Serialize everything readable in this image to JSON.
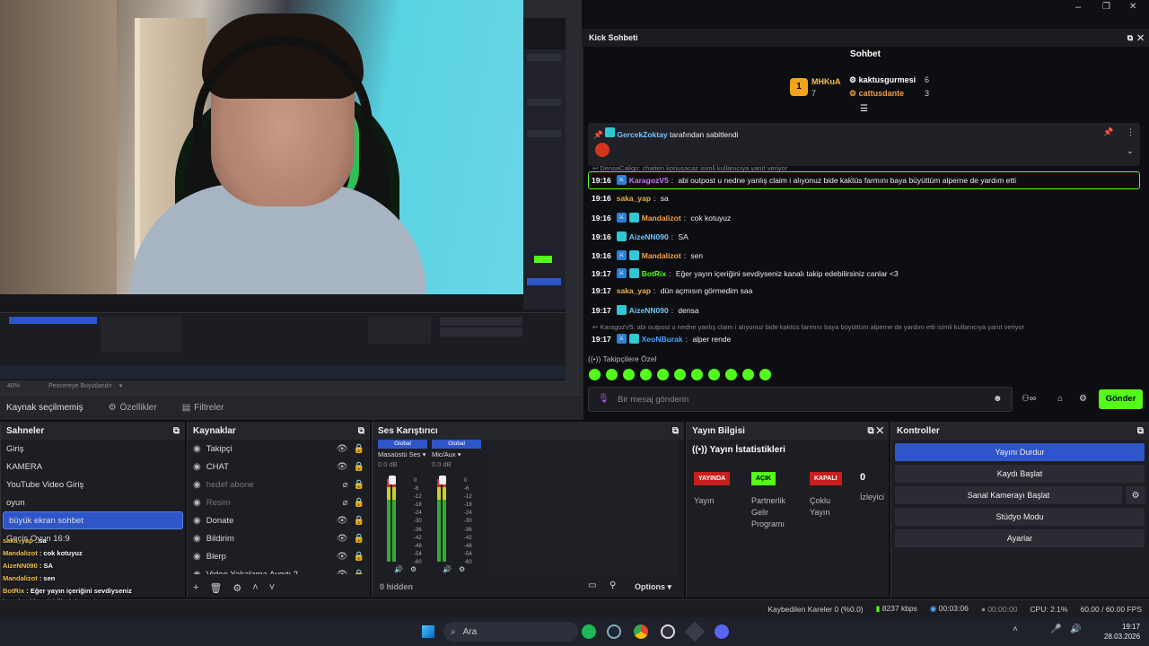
{
  "window": {
    "controls": [
      "–",
      "❐",
      "✕"
    ]
  },
  "preview": {
    "zoom": "48%",
    "fit_label": "Pencereye Boyutlandır"
  },
  "source_bar": {
    "status": "Kaynak seçilmemiş",
    "properties": "Özellikler",
    "filters": "Filtreler"
  },
  "scenes": {
    "title": "Sahneler",
    "items": [
      "Giriş",
      "KAMERA",
      "YouTube Video Giriş",
      "oyun",
      "büyük ekran sohbet",
      "Geçiş Oyun 16:9"
    ],
    "selected_index": 4
  },
  "sources": {
    "title": "Kaynaklar",
    "items": [
      {
        "name": "Takipçi",
        "visible": true
      },
      {
        "name": "CHAT",
        "visible": true
      },
      {
        "name": "hedef abone",
        "visible": false
      },
      {
        "name": "Resim",
        "visible": false
      },
      {
        "name": "Donate",
        "visible": true
      },
      {
        "name": "Bildirim",
        "visible": true
      },
      {
        "name": "Blerp",
        "visible": true
      },
      {
        "name": "Video Yakalama Aygıtı 2",
        "visible": true
      }
    ]
  },
  "mixer": {
    "title": "Ses Karıştırıcı",
    "channels": [
      {
        "label": "Global",
        "name": "Masaüstü Ses",
        "db": "0.0 dB",
        "level": 0.33
      },
      {
        "label": "Global",
        "name": "Mic/Aux",
        "db": "0.0 dB",
        "level": 0.33
      }
    ],
    "ticks": [
      "0",
      "-6",
      "-12",
      "-18",
      "-24",
      "-30",
      "-36",
      "-42",
      "-48",
      "-54",
      "-60"
    ],
    "hidden": "0 hidden",
    "options": "Options"
  },
  "stream_info": {
    "title": "Yayın Bilgisi",
    "stats_title": "Yayın İstatistikleri",
    "badges": [
      {
        "text": "YAYINDA",
        "color": "#c81e1e",
        "label": "Yayın"
      },
      {
        "text": "AÇIK",
        "color": "#53fc18",
        "label": "Partnerlik Gelir Programı"
      },
      {
        "text": "KAPALI",
        "color": "#c81e1e",
        "label": "Çoklu Yayın"
      }
    ],
    "viewers": "0",
    "viewers_label": "İzleyici"
  },
  "controls": {
    "title": "Kontroller",
    "buttons": [
      "Yayını Durdur",
      "Kaydı Başlat",
      "Sanal Kamerayı Başlat",
      "Stüdyo Modu",
      "Ayarlar"
    ]
  },
  "status_bar": {
    "dropped": "Kaybedilen Kareler 0 (%0.0)",
    "bitrate": "8237 kbps",
    "live_time": "00:03:06",
    "rec_time": "00:00:00",
    "cpu": "CPU: 2.1%",
    "fps": "60.00 / 60.00 FPS"
  },
  "kick": {
    "window_title": "Kick Sohbeti",
    "header": "Sohbet",
    "leaderboard": [
      {
        "rank": "1",
        "name": "MHKuA",
        "count": "7"
      },
      {
        "name": "kaktusgurmesi",
        "count": "6"
      },
      {
        "name": "cattusdante",
        "count": "3"
      }
    ],
    "pinned_by": "GercekZoktay",
    "pinned_suffix": "tarafından sabitlendi",
    "reply_hint_1": "DensaCaligo: chatten konuşacaz isimli kullanıcıya yanıt veriyor",
    "messages": [
      {
        "time": "19:16",
        "user": "KaragozV5",
        "color": "#d271ff",
        "text": "abi outpost u nedne yanlış claim i alıyonuz bide kaktüs farmını baya büyüttüm alperne de yardım etti"
      },
      {
        "time": "19:16",
        "user": "saka_yap",
        "color": "#e8b04a",
        "text": "sa"
      },
      {
        "time": "19:16",
        "user": "Mandalizot",
        "color": "#f4a24a",
        "text": "cok kotuyuz"
      },
      {
        "time": "19:16",
        "user": "AizeNN090",
        "color": "#6fc5ff",
        "text": "SA"
      },
      {
        "time": "19:16",
        "user": "Mandalizot",
        "color": "#f4a24a",
        "text": "sen"
      },
      {
        "time": "19:17",
        "user": "BotRix",
        "color": "#53fc18",
        "text": "Eğer yayın içeriğini sevdiyseniz kanalı takip edebilirsiniz canlar <3"
      },
      {
        "time": "19:17",
        "user": "saka_yap",
        "color": "#e8b04a",
        "text": "dün açmısın görmedim saa"
      },
      {
        "time": "19:17",
        "user": "AizeNN090",
        "color": "#6fc5ff",
        "text": "densa"
      },
      {
        "time": "19:17",
        "user": "XeoNBurak",
        "color": "#4aa3ff",
        "text": "alper rende"
      }
    ],
    "reply_hint_2": "KaragozV5: abi outpost u nedne yanlış claim i alıyonuz bide kaktüs farmını baya büyüttüm alperne de yardım etti isimli kullanıcıya yanıt veriyor",
    "followers_only": "Takipçilere Özel",
    "input_placeholder": "Bir mesaj gönderin",
    "send": "Gönder"
  },
  "overlay_chat": [
    {
      "user": "saka_yap",
      "text": "sa"
    },
    {
      "user": "Mandalizot",
      "text": "cok kotuyuz"
    },
    {
      "user": "AizeNN090",
      "text": "SA"
    },
    {
      "user": "Mandalizot",
      "text": "sen"
    },
    {
      "user": "BotRix",
      "text": "Eğer yayın içeriğini sevdiyseniz"
    },
    {
      "user": "",
      "text": "kanalı takip edebilirsiniz canlar <3"
    },
    {
      "user": "saka_yap",
      "text": "dün açmısın görmedim saa"
    },
    {
      "user": "AizeNN090",
      "text": "densa"
    },
    {
      "user": "XeoNBurak",
      "text": "alper rende"
    }
  ],
  "taskbar": {
    "search": "Ara",
    "time": "19:17",
    "date": "28.03.2026"
  }
}
